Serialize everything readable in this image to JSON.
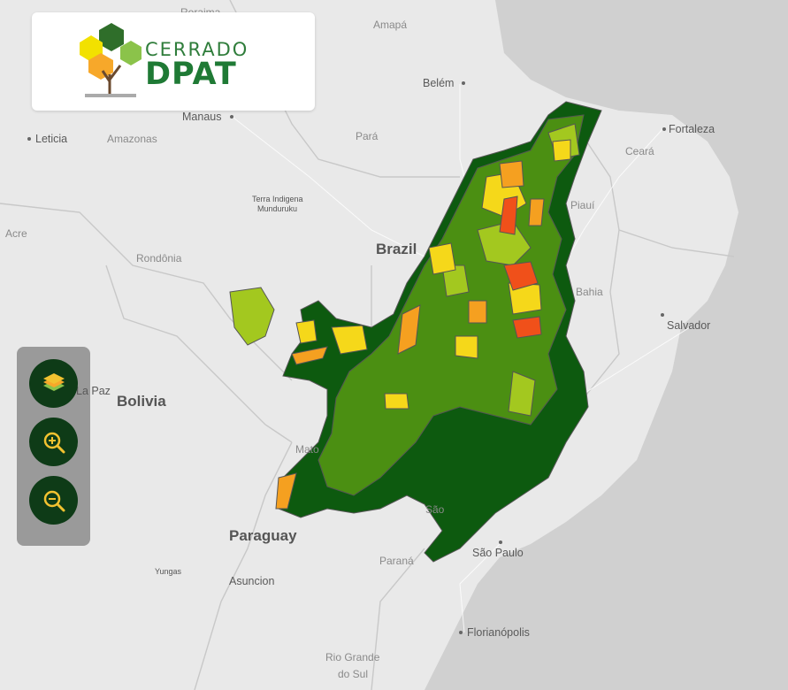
{
  "map": {
    "labels": {
      "country_brazil": "Brazil",
      "country_bolivia": "Bolivia",
      "country_paraguay": "Paraguay",
      "roraima": "Roraima",
      "amapa": "Amapá",
      "belem": "Belém",
      "manaus": "Manaus",
      "leticia": "Leticia",
      "amazonas": "Amazonas",
      "para": "Pará",
      "fortaleza": "Fortaleza",
      "ceara": "Ceará",
      "terra_indigena_1": "Terra Indigena",
      "terra_indigena_2": "Munduruku",
      "acre": "Acre",
      "rondonia": "Rondônia",
      "piaui": "Piauí",
      "bahia": "Bahia",
      "salvador": "Salvador",
      "la_paz": "La Paz",
      "mato": "Mato",
      "sao": "São",
      "sao_paulo": "São Paulo",
      "parana": "Paraná",
      "yungas": "Yungas",
      "asuncion": "Asuncion",
      "florianopolis": "Florianópolis",
      "rio_grande_1": "Rio Grande",
      "rio_grande_2": "do Sul"
    },
    "colors": {
      "background": "#d4d4d4",
      "land": "#e8e8e8",
      "ocean": "#cfcfcf",
      "region_dark_green": "#0d5a0f",
      "region_green": "#4b8f12",
      "region_light_green": "#a3c81f",
      "region_yellow": "#f5d81a",
      "region_orange": "#f5a020",
      "region_red": "#f0501a",
      "region_border": "#555555"
    }
  },
  "logo": {
    "line1": "CERRADO",
    "line2": "DPAT"
  },
  "controls": {
    "layers_icon": "layers-icon",
    "zoom_in_icon": "zoom-in-icon",
    "zoom_out_icon": "zoom-out-icon",
    "accent": "#0e3b17",
    "icon_color": "#f2c230"
  }
}
